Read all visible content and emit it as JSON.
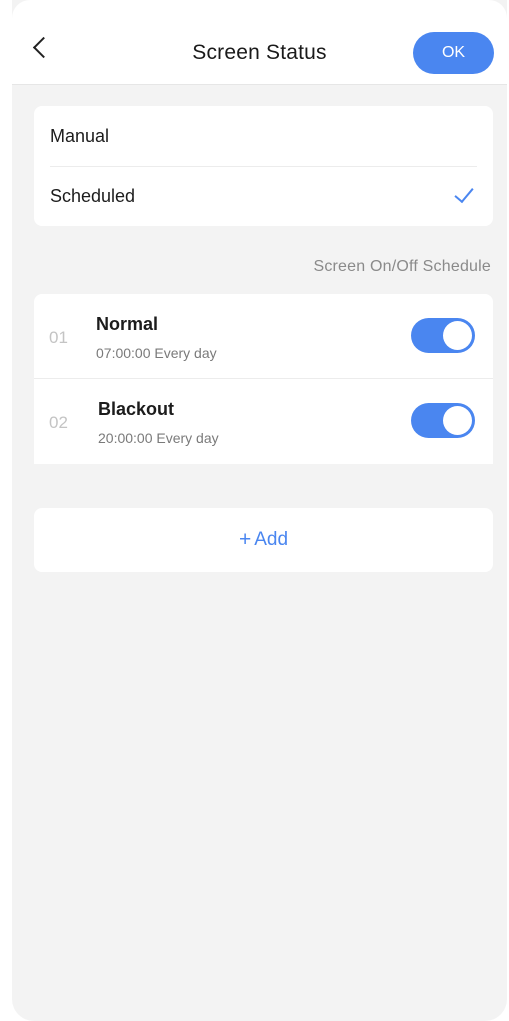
{
  "header": {
    "title": "Screen Status",
    "ok_label": "OK"
  },
  "mode": {
    "options": [
      {
        "label": "Manual",
        "selected": false
      },
      {
        "label": "Scheduled",
        "selected": true
      }
    ]
  },
  "schedule": {
    "section_label": "Screen On/Off Schedule",
    "items": [
      {
        "index": "01",
        "name": "Normal",
        "detail": "07:00:00 Every day",
        "enabled": true
      },
      {
        "index": "02",
        "name": "Blackout",
        "detail": "20:00:00 Every day",
        "enabled": true
      }
    ],
    "add_plus": "+",
    "add_label": "Add"
  },
  "colors": {
    "accent": "#4a86f0",
    "background": "#f3f3f3"
  },
  "icons": {
    "back": "chevron-left-icon",
    "selected": "checkmark-icon"
  }
}
